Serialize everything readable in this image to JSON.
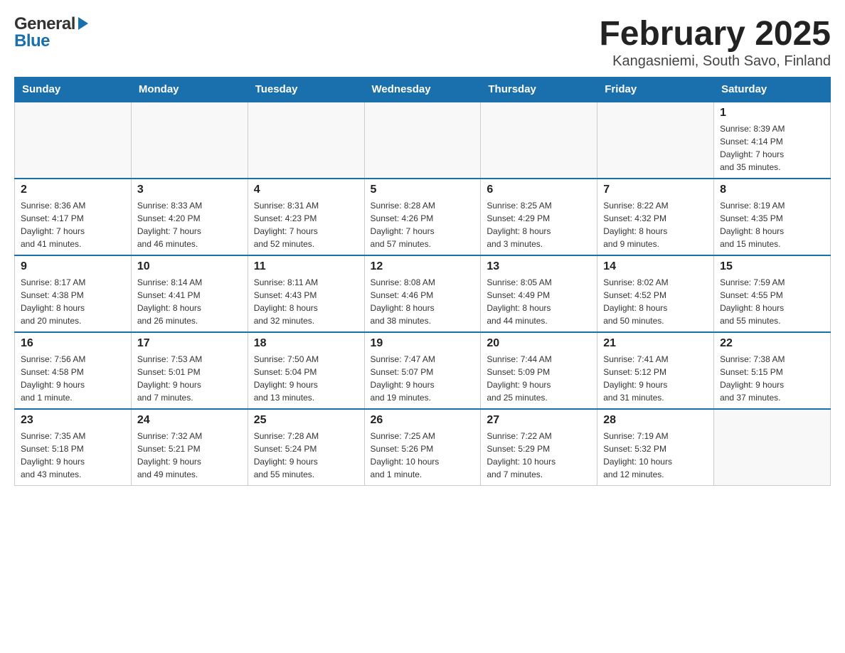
{
  "header": {
    "logo_general": "General",
    "logo_blue": "Blue",
    "title": "February 2025",
    "subtitle": "Kangasniemi, South Savo, Finland"
  },
  "weekdays": [
    "Sunday",
    "Monday",
    "Tuesday",
    "Wednesday",
    "Thursday",
    "Friday",
    "Saturday"
  ],
  "weeks": [
    {
      "days": [
        {
          "num": "",
          "info": ""
        },
        {
          "num": "",
          "info": ""
        },
        {
          "num": "",
          "info": ""
        },
        {
          "num": "",
          "info": ""
        },
        {
          "num": "",
          "info": ""
        },
        {
          "num": "",
          "info": ""
        },
        {
          "num": "1",
          "info": "Sunrise: 8:39 AM\nSunset: 4:14 PM\nDaylight: 7 hours\nand 35 minutes."
        }
      ]
    },
    {
      "days": [
        {
          "num": "2",
          "info": "Sunrise: 8:36 AM\nSunset: 4:17 PM\nDaylight: 7 hours\nand 41 minutes."
        },
        {
          "num": "3",
          "info": "Sunrise: 8:33 AM\nSunset: 4:20 PM\nDaylight: 7 hours\nand 46 minutes."
        },
        {
          "num": "4",
          "info": "Sunrise: 8:31 AM\nSunset: 4:23 PM\nDaylight: 7 hours\nand 52 minutes."
        },
        {
          "num": "5",
          "info": "Sunrise: 8:28 AM\nSunset: 4:26 PM\nDaylight: 7 hours\nand 57 minutes."
        },
        {
          "num": "6",
          "info": "Sunrise: 8:25 AM\nSunset: 4:29 PM\nDaylight: 8 hours\nand 3 minutes."
        },
        {
          "num": "7",
          "info": "Sunrise: 8:22 AM\nSunset: 4:32 PM\nDaylight: 8 hours\nand 9 minutes."
        },
        {
          "num": "8",
          "info": "Sunrise: 8:19 AM\nSunset: 4:35 PM\nDaylight: 8 hours\nand 15 minutes."
        }
      ]
    },
    {
      "days": [
        {
          "num": "9",
          "info": "Sunrise: 8:17 AM\nSunset: 4:38 PM\nDaylight: 8 hours\nand 20 minutes."
        },
        {
          "num": "10",
          "info": "Sunrise: 8:14 AM\nSunset: 4:41 PM\nDaylight: 8 hours\nand 26 minutes."
        },
        {
          "num": "11",
          "info": "Sunrise: 8:11 AM\nSunset: 4:43 PM\nDaylight: 8 hours\nand 32 minutes."
        },
        {
          "num": "12",
          "info": "Sunrise: 8:08 AM\nSunset: 4:46 PM\nDaylight: 8 hours\nand 38 minutes."
        },
        {
          "num": "13",
          "info": "Sunrise: 8:05 AM\nSunset: 4:49 PM\nDaylight: 8 hours\nand 44 minutes."
        },
        {
          "num": "14",
          "info": "Sunrise: 8:02 AM\nSunset: 4:52 PM\nDaylight: 8 hours\nand 50 minutes."
        },
        {
          "num": "15",
          "info": "Sunrise: 7:59 AM\nSunset: 4:55 PM\nDaylight: 8 hours\nand 55 minutes."
        }
      ]
    },
    {
      "days": [
        {
          "num": "16",
          "info": "Sunrise: 7:56 AM\nSunset: 4:58 PM\nDaylight: 9 hours\nand 1 minute."
        },
        {
          "num": "17",
          "info": "Sunrise: 7:53 AM\nSunset: 5:01 PM\nDaylight: 9 hours\nand 7 minutes."
        },
        {
          "num": "18",
          "info": "Sunrise: 7:50 AM\nSunset: 5:04 PM\nDaylight: 9 hours\nand 13 minutes."
        },
        {
          "num": "19",
          "info": "Sunrise: 7:47 AM\nSunset: 5:07 PM\nDaylight: 9 hours\nand 19 minutes."
        },
        {
          "num": "20",
          "info": "Sunrise: 7:44 AM\nSunset: 5:09 PM\nDaylight: 9 hours\nand 25 minutes."
        },
        {
          "num": "21",
          "info": "Sunrise: 7:41 AM\nSunset: 5:12 PM\nDaylight: 9 hours\nand 31 minutes."
        },
        {
          "num": "22",
          "info": "Sunrise: 7:38 AM\nSunset: 5:15 PM\nDaylight: 9 hours\nand 37 minutes."
        }
      ]
    },
    {
      "days": [
        {
          "num": "23",
          "info": "Sunrise: 7:35 AM\nSunset: 5:18 PM\nDaylight: 9 hours\nand 43 minutes."
        },
        {
          "num": "24",
          "info": "Sunrise: 7:32 AM\nSunset: 5:21 PM\nDaylight: 9 hours\nand 49 minutes."
        },
        {
          "num": "25",
          "info": "Sunrise: 7:28 AM\nSunset: 5:24 PM\nDaylight: 9 hours\nand 55 minutes."
        },
        {
          "num": "26",
          "info": "Sunrise: 7:25 AM\nSunset: 5:26 PM\nDaylight: 10 hours\nand 1 minute."
        },
        {
          "num": "27",
          "info": "Sunrise: 7:22 AM\nSunset: 5:29 PM\nDaylight: 10 hours\nand 7 minutes."
        },
        {
          "num": "28",
          "info": "Sunrise: 7:19 AM\nSunset: 5:32 PM\nDaylight: 10 hours\nand 12 minutes."
        },
        {
          "num": "",
          "info": ""
        }
      ]
    }
  ]
}
